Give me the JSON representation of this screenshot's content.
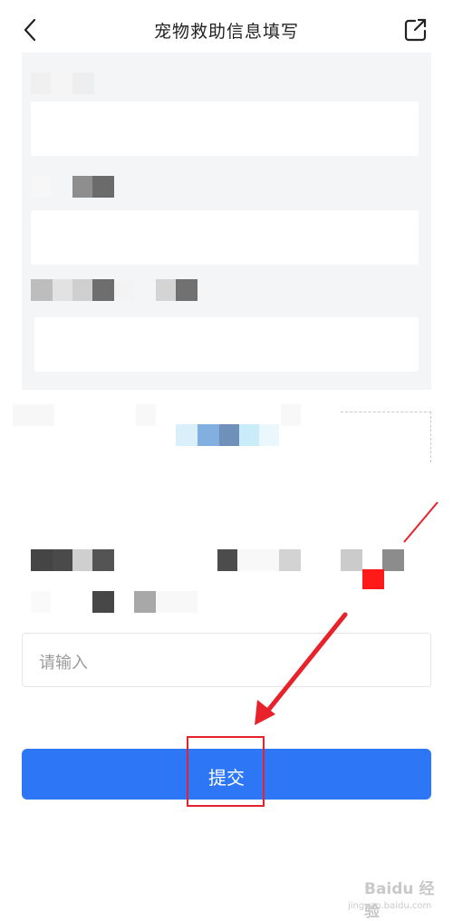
{
  "header": {
    "title": "宠物救助信息填写",
    "back_icon": "chevron-left-icon",
    "share_icon": "share-icon"
  },
  "remark": {
    "placeholder": "请输入"
  },
  "submit": {
    "label": "提交"
  },
  "watermark": {
    "brand": "Baidu 经验",
    "url": "jingyan.baidu.com"
  },
  "colors": {
    "primary": "#2d76f6",
    "annotation": "#e8222a",
    "card_background": "#f4f5f7"
  }
}
